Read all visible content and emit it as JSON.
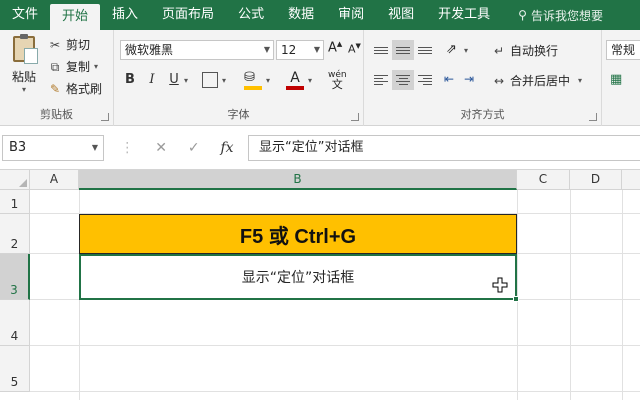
{
  "tabs": [
    "文件",
    "开始",
    "插入",
    "页面布局",
    "公式",
    "数据",
    "审阅",
    "视图",
    "开发工具"
  ],
  "active_tab": "开始",
  "tell_me": "告诉我您想要",
  "clipboard": {
    "paste": "粘贴",
    "cut": "剪切",
    "copy": "复制",
    "format_painter": "格式刷",
    "label": "剪贴板"
  },
  "font": {
    "name": "微软雅黑",
    "size": "12",
    "grow": "A",
    "shrink": "A",
    "bold": "B",
    "italic": "I",
    "underline": "U",
    "phonetic": "wén",
    "label": "字体"
  },
  "alignment": {
    "wrap_text": "自动换行",
    "merge_center": "合并后居中",
    "label": "对齐方式"
  },
  "number": {
    "format": "常规"
  },
  "formula_bar": {
    "name_box": "B3",
    "fx": "fx",
    "content": "显示“定位”对话框"
  },
  "columns": [
    "A",
    "B",
    "C",
    "D"
  ],
  "rows": [
    "1",
    "2",
    "3",
    "4",
    "5"
  ],
  "cells": {
    "B2": "F5 或 Ctrl+G",
    "B3": "显示“定位”对话框"
  },
  "colors": {
    "accent": "#217346",
    "title_fill": "#ffc000"
  }
}
